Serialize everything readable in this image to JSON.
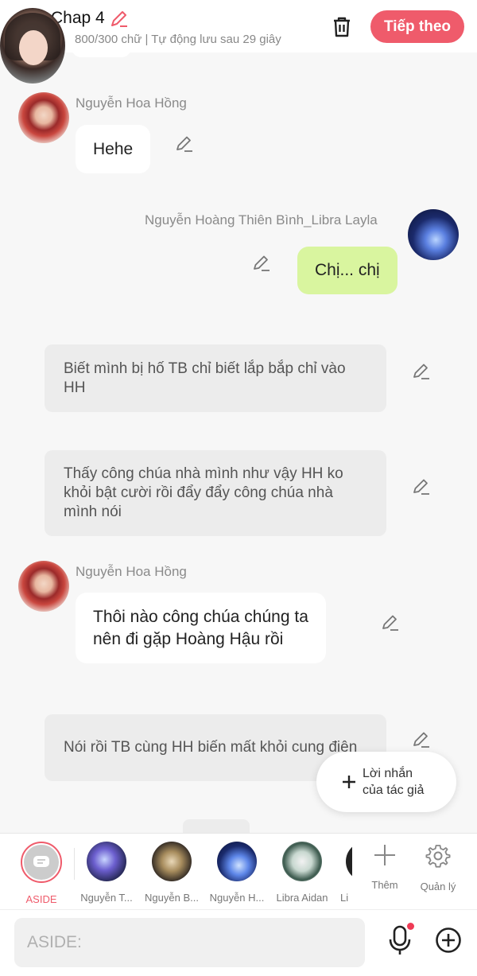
{
  "header": {
    "title": "Chap 4",
    "subtitle": "800/300 chữ | Tự động lưu sau 29 giây",
    "next_label": "Tiếp theo"
  },
  "messages": [
    {
      "speaker": "Nguyễn Hoa Hồng",
      "text": "Hehe"
    },
    {
      "speaker": "Nguyễn Hoàng Thiên Bình_Libra Layla",
      "text": "Chị... chị"
    },
    {
      "narration": "Biết mình bị hố TB chỉ biết lắp bắp chỉ vào HH"
    },
    {
      "narration": "Thấy công chúa nhà mình như vậy HH ko khỏi bật cười rồi đẩy đẩy công chúa nhà mình nói"
    },
    {
      "speaker": "Nguyễn Hoa Hồng",
      "text_line1": "Thôi nào công chúa chúng ta",
      "text_line2": "nên đi gặp Hoàng Hậu rồi"
    },
    {
      "narration": "Nói rồi TB cùng HH biến mất khỏi cung điện"
    }
  ],
  "fab": {
    "line1": "Lời nhắn",
    "line2": "của tác giả"
  },
  "characters": {
    "aside": "ASIDE",
    "items": [
      "Nguyễn T...",
      "Nguyễn B...",
      "Nguyễn H...",
      "Libra Aidan",
      "Li"
    ],
    "more": "Thêm",
    "manage": "Quản lý"
  },
  "input": {
    "placeholder": "ASIDE:"
  },
  "colors": {
    "accent": "#ef5b6b",
    "green_bubble": "#d9f59f",
    "narration_bg": "#ececec"
  }
}
